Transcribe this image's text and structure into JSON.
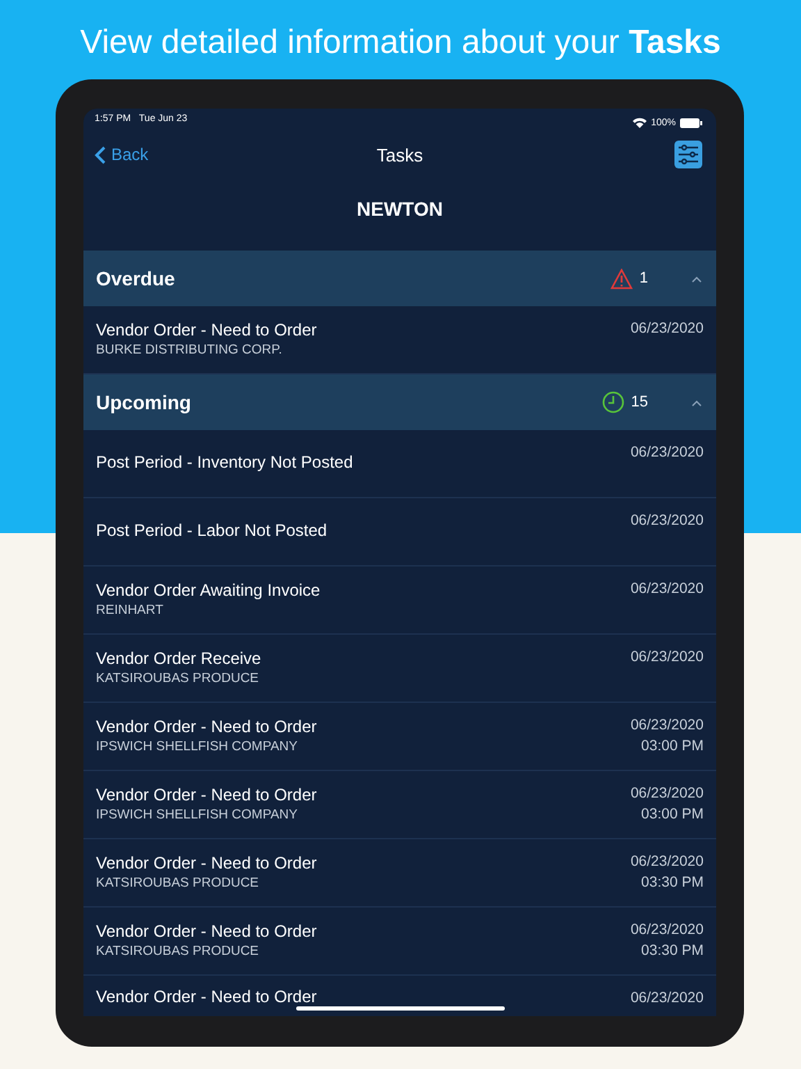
{
  "headline": "View detailed information about your **Tasks**",
  "status_bar": {
    "time": "1:57 PM",
    "date": "Tue Jun 23",
    "battery": "100%"
  },
  "nav": {
    "back": "Back",
    "title": "Tasks"
  },
  "location": "NEWTON",
  "sections": [
    {
      "title": "Overdue",
      "kind": "overdue",
      "count": "1",
      "expanded": true,
      "tasks": [
        {
          "title": "Vendor Order - Need to Order",
          "subtitle": "BURKE DISTRIBUTING CORP.",
          "date": "06/23/2020"
        }
      ]
    },
    {
      "title": "Upcoming",
      "kind": "upcoming",
      "count": "15",
      "expanded": true,
      "tasks": [
        {
          "title": "Post Period - Inventory Not Posted",
          "date": "06/23/2020"
        },
        {
          "title": "Post Period - Labor Not Posted",
          "date": "06/23/2020"
        },
        {
          "title": "Vendor Order Awaiting Invoice",
          "subtitle": "REINHART",
          "date": "06/23/2020"
        },
        {
          "title": "Vendor Order Receive",
          "subtitle": "KATSIROUBAS PRODUCE",
          "date": "06/23/2020"
        },
        {
          "title": "Vendor Order - Need to Order",
          "subtitle": "IPSWICH SHELLFISH COMPANY",
          "date": "06/23/2020",
          "time": "03:00 PM"
        },
        {
          "title": "Vendor Order - Need to Order",
          "subtitle": "IPSWICH SHELLFISH COMPANY",
          "date": "06/23/2020",
          "time": "03:00 PM"
        },
        {
          "title": "Vendor Order - Need to Order",
          "subtitle": "KATSIROUBAS PRODUCE",
          "date": "06/23/2020",
          "time": "03:30 PM"
        },
        {
          "title": "Vendor Order - Need to Order",
          "subtitle": "KATSIROUBAS PRODUCE",
          "date": "06/23/2020",
          "time": "03:30 PM"
        },
        {
          "title": "Vendor Order - Need to Order",
          "date": "06/23/2020"
        }
      ]
    }
  ]
}
